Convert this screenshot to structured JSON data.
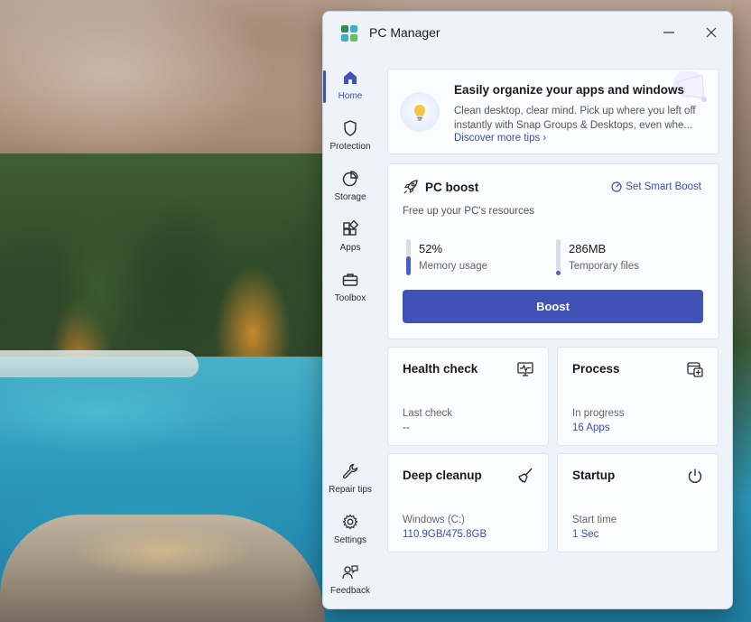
{
  "window": {
    "title": "PC Manager"
  },
  "colors": {
    "accent": "#4052b5",
    "link": "#3a4fb0"
  },
  "sidebar": {
    "items": [
      {
        "label": "Home",
        "icon": "home-icon",
        "active": true
      },
      {
        "label": "Protection",
        "icon": "shield-icon"
      },
      {
        "label": "Storage",
        "icon": "pie-chart-icon"
      },
      {
        "label": "Apps",
        "icon": "apps-grid-icon"
      },
      {
        "label": "Toolbox",
        "icon": "toolbox-icon"
      },
      {
        "label": "Repair tips",
        "icon": "wrench-icon"
      },
      {
        "label": "Settings",
        "icon": "gear-icon"
      },
      {
        "label": "Feedback",
        "icon": "feedback-icon"
      }
    ]
  },
  "tip": {
    "title": "Easily organize your apps and windows",
    "body_line1": "Clean desktop, clear mind. Pick up where you left off",
    "body_line2": "instantly with Snap Groups & Desktops, even whe...",
    "link": "Discover more tips ›"
  },
  "boost": {
    "title": "PC boost",
    "smart_boost": "Set Smart Boost",
    "subtitle": "Free up your PC's resources",
    "memory_value": "52%",
    "memory_label": "Memory usage",
    "memory_fraction": 0.52,
    "temp_value": "286MB",
    "temp_label": "Temporary files",
    "temp_fraction": 0.12,
    "button": "Boost"
  },
  "tiles": {
    "health": {
      "title": "Health check",
      "line1": "Last check",
      "line2": "--"
    },
    "process": {
      "title": "Process",
      "line1": "In progress",
      "line2": "16 Apps"
    },
    "cleanup": {
      "title": "Deep cleanup",
      "line1": "Windows (C:)",
      "line2": "110.9GB/475.8GB"
    },
    "startup": {
      "title": "Startup",
      "line1": "Start time",
      "line2": "1 Sec"
    }
  }
}
